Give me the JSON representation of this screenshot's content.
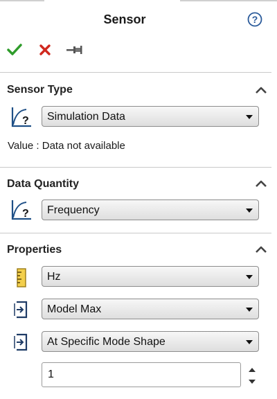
{
  "panel": {
    "title": "Sensor",
    "icons": {
      "help": "help-icon",
      "ok": "checkmark-icon",
      "cancel": "close-icon",
      "pin": "pushpin-icon"
    },
    "colors": {
      "ok": "#2f9c2b",
      "cancel": "#d0281e"
    }
  },
  "sensor_type": {
    "title": "Sensor Type",
    "icon": "sensor-curve-icon",
    "selected": "Simulation Data",
    "value_text": "Value : Data not available"
  },
  "data_quantity": {
    "title": "Data Quantity",
    "icon": "sensor-curve-icon",
    "selected": "Frequency"
  },
  "properties": {
    "title": "Properties",
    "units_icon": "ruler-icon",
    "units": "Hz",
    "criterion_icon": "criterion-icon",
    "criterion": "Model Max",
    "step_icon": "step-criterion-icon",
    "step_criterion": "At Specific Mode Shape",
    "mode_number": "1"
  }
}
